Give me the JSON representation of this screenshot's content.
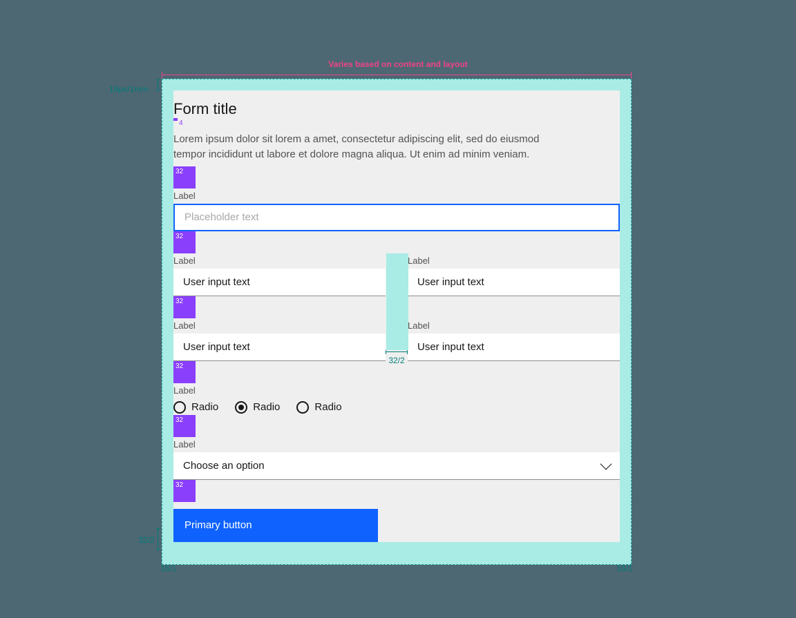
{
  "annotations": {
    "topWidth": "Varies based on content and layout",
    "topPadding": "16px/1rem",
    "bottomPadding": "32/2",
    "sidePaddingLeft": "16/1",
    "sidePaddingRight": "16/1",
    "colGap": "32/2",
    "spacer4": "4",
    "spacer32": "32"
  },
  "form": {
    "title": "Form title",
    "description": "Lorem ipsum dolor sit lorem a amet, consectetur adipiscing elit, sed do eiusmod tempor incididunt ut labore et dolore magna aliqua. Ut enim ad minim veniam.",
    "field1": {
      "label": "Label",
      "placeholder": "Placeholder text"
    },
    "row1": {
      "left": {
        "label": "Label",
        "value": "User input text"
      },
      "right": {
        "label": "Label",
        "value": "User input text"
      }
    },
    "row2": {
      "left": {
        "label": "Label",
        "value": "User input text"
      },
      "right": {
        "label": "Label",
        "value": "User input text"
      }
    },
    "radio": {
      "label": "Label",
      "options": [
        "Radio",
        "Radio",
        "Radio"
      ],
      "selectedIndex": 1
    },
    "select": {
      "label": "Label",
      "placeholder": "Choose an option"
    },
    "button": "Primary button"
  }
}
